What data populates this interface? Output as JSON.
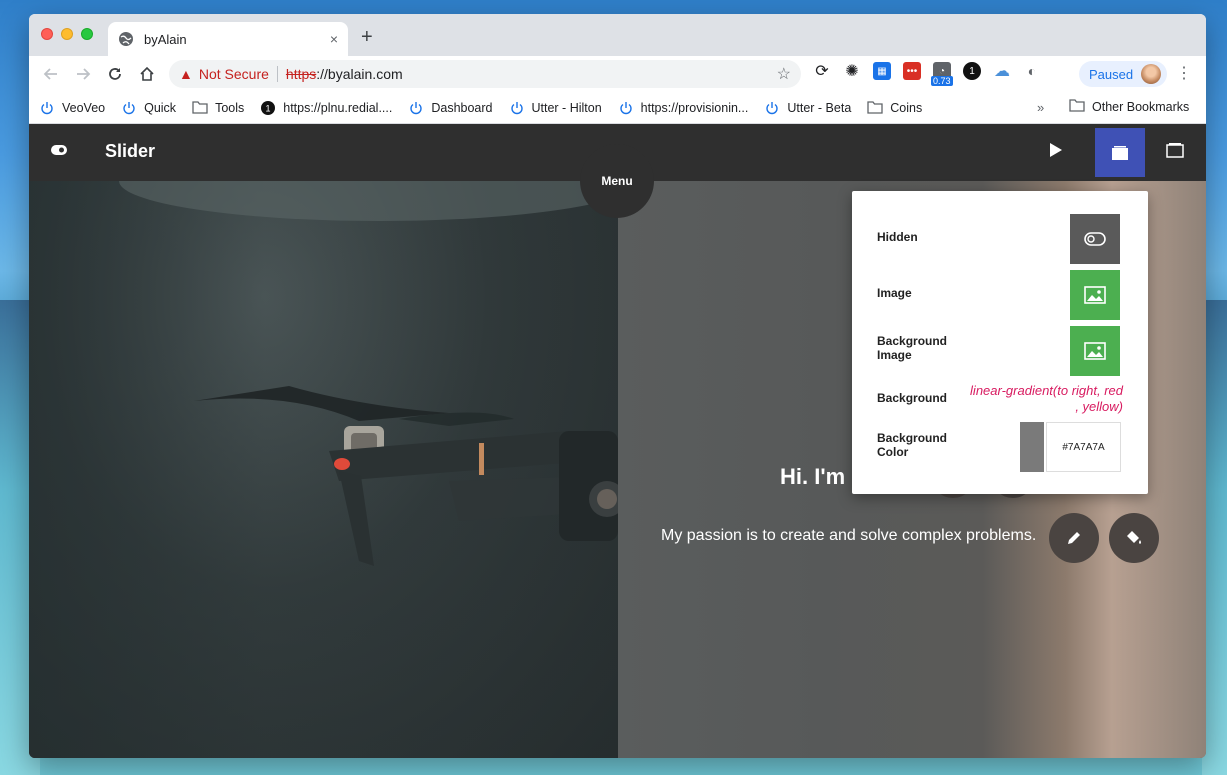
{
  "browser": {
    "tab": {
      "title": "byAlain",
      "close": "×"
    },
    "new_tab": "+",
    "address": {
      "warning": "Not Secure",
      "scheme": "https",
      "rest": "://byalain.com"
    },
    "extension_badge": "0.73",
    "extension_counter": "1",
    "profile": "Paused",
    "bookmarks": [
      {
        "label": "VeoVeo",
        "icon": "power-icon"
      },
      {
        "label": "Quick",
        "icon": "power-icon"
      },
      {
        "label": "Tools",
        "icon": "folder-icon"
      },
      {
        "label": "https://plnu.redial....",
        "icon": "onepassword-icon"
      },
      {
        "label": "Dashboard",
        "icon": "power-icon"
      },
      {
        "label": "Utter - Hilton",
        "icon": "power-icon"
      },
      {
        "label": "https://provisionin...",
        "icon": "power-icon"
      },
      {
        "label": "Utter - Beta",
        "icon": "power-icon"
      },
      {
        "label": "Coins",
        "icon": "folder-icon"
      }
    ],
    "bookmarks_more": "»",
    "other_bookmarks": "Other Bookmarks",
    "onepassword_badge": "1"
  },
  "app": {
    "title": "Slider",
    "menu_label": "Menu",
    "accent_color": "#3f51b5"
  },
  "hero": {
    "title": "Hi. I'm",
    "subtitle": "My passion is to create and solve complex problems."
  },
  "panel": {
    "rows": [
      {
        "label": "Hidden",
        "kind": "toggle"
      },
      {
        "label": "Image",
        "kind": "image"
      },
      {
        "label_line1": "Background",
        "label_line2": "Image",
        "kind": "image"
      },
      {
        "label": "Background",
        "value": "linear-gradient(to right, red , yellow)"
      },
      {
        "label_line1": "Background",
        "label_line2": "Color",
        "value": "#7A7A7A",
        "swatch": "#7a7a7a"
      }
    ]
  }
}
